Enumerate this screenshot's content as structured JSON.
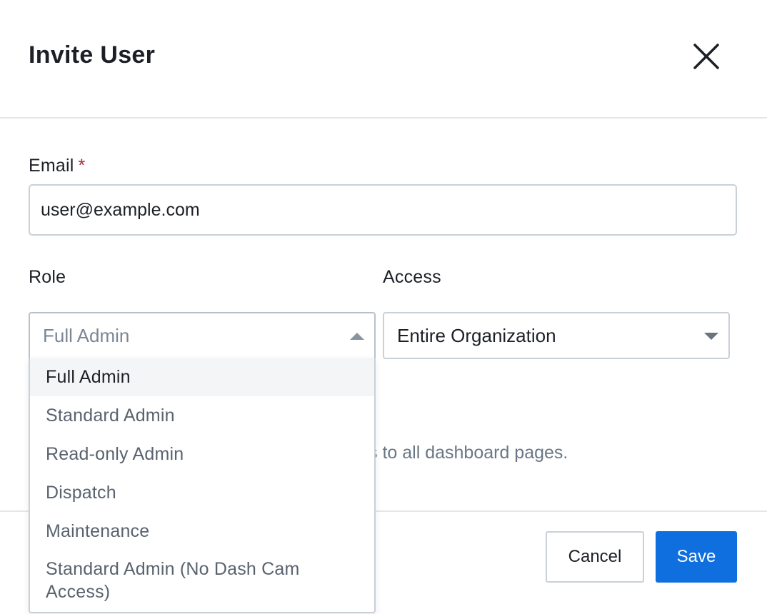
{
  "header": {
    "title": "Invite User"
  },
  "form": {
    "email": {
      "label": "Email",
      "required_marker": "*",
      "value": "user@example.com"
    },
    "role": {
      "label": "Role",
      "selected": "Full Admin",
      "open": true,
      "options": [
        "Full Admin",
        "Standard Admin",
        "Read-only Admin",
        "Dispatch",
        "Maintenance",
        "Standard Admin (No Dash Cam Access)"
      ],
      "highlighted_option": "Full Admin"
    },
    "access": {
      "label": "Access",
      "selected": "Entire Organization"
    },
    "helper_text": "s to all dashboard pages."
  },
  "footer": {
    "cancel_label": "Cancel",
    "save_label": "Save"
  },
  "colors": {
    "primary": "#0f6fde",
    "required": "#b0262e",
    "border": "#c9d0d7",
    "muted_text": "#6a7786"
  },
  "icons": {
    "close": "close-icon",
    "role_caret": "caret-up-icon",
    "access_caret": "caret-down-icon"
  }
}
